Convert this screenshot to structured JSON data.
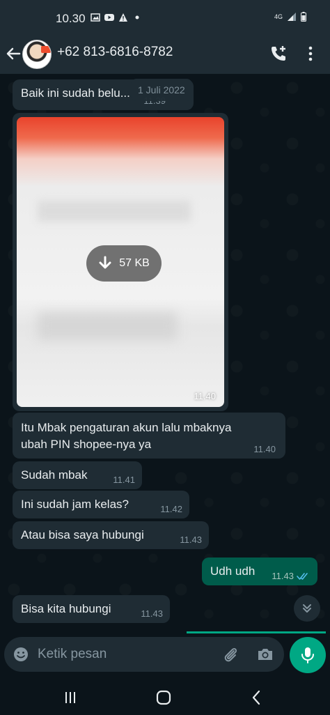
{
  "status_bar": {
    "time": "10.30",
    "network": "4G"
  },
  "header": {
    "contact_name": "+62 813-6816-8782"
  },
  "chat": {
    "date_chip": "1 Juli 2022",
    "messages": [
      {
        "text": "Baik ini sudah belu...",
        "time": "11.39",
        "direction": "in"
      },
      {
        "type": "image",
        "download_size": "57 KB",
        "time": "11.40",
        "direction": "in"
      },
      {
        "text": "Itu Mbak pengaturan akun lalu mbaknya ubah PIN shopee-nya ya",
        "time": "11.40",
        "direction": "in"
      },
      {
        "text": "Sudah mbak",
        "time": "11.41",
        "direction": "in"
      },
      {
        "text": "Ini sudah jam kelas?",
        "time": "11.42",
        "direction": "in"
      },
      {
        "text": "Atau bisa saya hubungi",
        "time": "11.43",
        "direction": "in"
      },
      {
        "text": "Udh udh",
        "time": "11.43",
        "direction": "out",
        "status": "read"
      },
      {
        "text": "Bisa kita hubungi",
        "time": "11.43",
        "direction": "in"
      }
    ]
  },
  "input_bar": {
    "placeholder": "Ketik pesan"
  },
  "colors": {
    "background": "#0b141a",
    "incoming_bubble": "#1f2c34",
    "outgoing_bubble": "#005c4b",
    "accent": "#00a884",
    "read_ticks": "#53bdeb"
  }
}
